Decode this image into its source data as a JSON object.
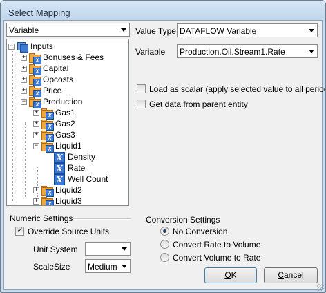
{
  "window": {
    "title": "Select Mapping"
  },
  "left": {
    "category_combo": "Variable"
  },
  "tree": {
    "root": "Inputs",
    "nodes": [
      {
        "label": "Bonuses & Fees",
        "type": "folder"
      },
      {
        "label": "Capital",
        "type": "folder"
      },
      {
        "label": "Opcosts",
        "type": "folder"
      },
      {
        "label": "Price",
        "type": "folder"
      },
      {
        "label": "Production",
        "type": "folder"
      },
      {
        "label": "Gas1",
        "type": "folder"
      },
      {
        "label": "Gas2",
        "type": "folder"
      },
      {
        "label": "Gas3",
        "type": "folder"
      },
      {
        "label": "Liquid1",
        "type": "folder"
      },
      {
        "label": "Density",
        "type": "variable"
      },
      {
        "label": "Rate",
        "type": "variable"
      },
      {
        "label": "Well Count",
        "type": "variable"
      },
      {
        "label": "Liquid2",
        "type": "folder"
      },
      {
        "label": "Liquid3",
        "type": "folder"
      }
    ]
  },
  "right": {
    "value_type_label": "Value Type",
    "value_type_value": "DATAFLOW Variable",
    "variable_label": "Variable",
    "variable_value": "Production.Oil.Stream1.Rate",
    "load_as_scalar_label": "Load as scalar (apply selected value to all periods)",
    "load_as_scalar_checked": false,
    "parent_entity_label": "Get data from parent entity",
    "parent_entity_checked": false
  },
  "numeric": {
    "title": "Numeric Settings",
    "override_label": "Override Source Units",
    "override_checked": true,
    "unit_system_label": "Unit System",
    "unit_system_value": "",
    "scale_size_label": "ScaleSize",
    "scale_size_value": "Medium"
  },
  "conversion": {
    "title": "Conversion Settings",
    "options": [
      "No Conversion",
      "Convert Rate to Volume",
      "Convert Volume to Rate"
    ],
    "selected": 0
  },
  "buttons": {
    "ok_label": "OK",
    "ok_mnemonic": "O",
    "ok_rest": "K",
    "cancel_label": "Cancel",
    "cancel_mnemonic": "C",
    "cancel_rest": "ancel"
  },
  "icons": {
    "tree_expand_open": "−",
    "tree_expand_closed": "+",
    "variable_glyph": "X"
  },
  "colors": {
    "title_bar": "#c9dcef",
    "folder": "#f3a63a",
    "variable_icon": "#3b78d4"
  }
}
